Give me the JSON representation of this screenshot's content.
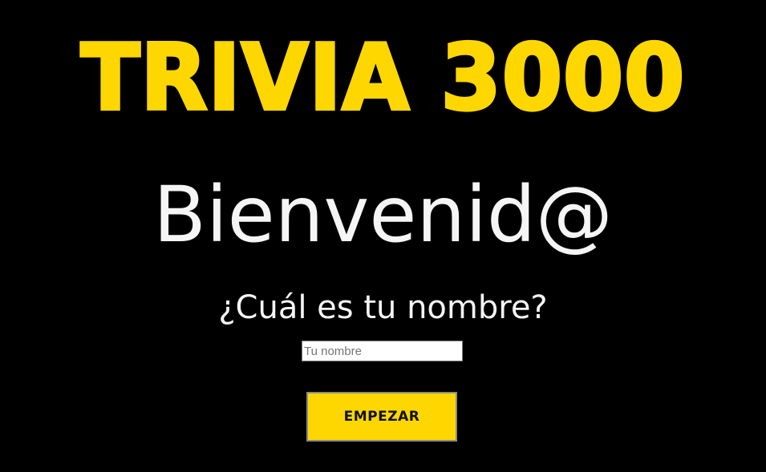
{
  "header": {
    "title": "TRIVIA 3000"
  },
  "main": {
    "welcome": "Bienvenid@",
    "prompt": "¿Cuál es tu nombre?",
    "name_input": {
      "value": "",
      "placeholder": "Tu nombre"
    },
    "start_button_label": "EMPEZAR"
  },
  "colors": {
    "background": "#000000",
    "accent": "#FFD700",
    "text": "#F5F5F5"
  }
}
